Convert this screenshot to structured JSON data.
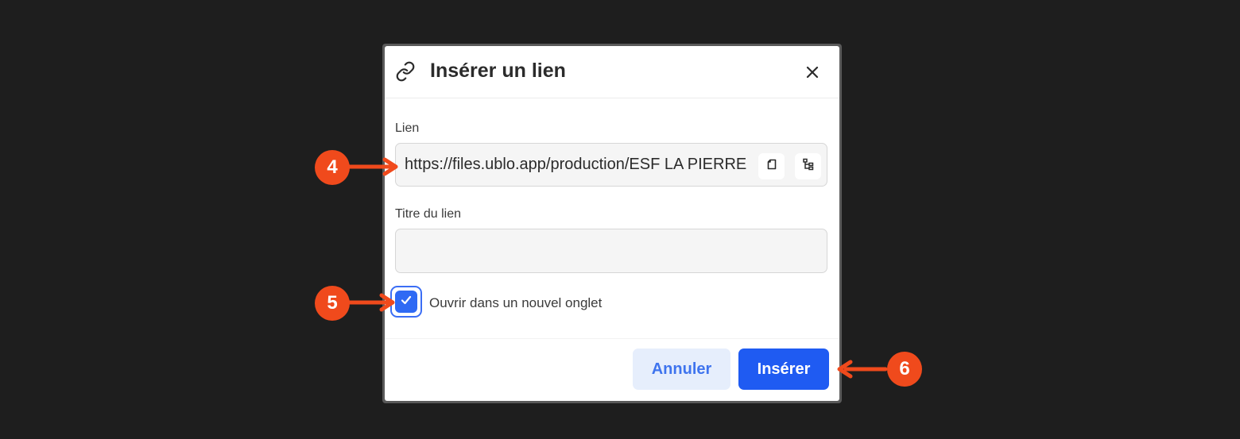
{
  "dialog": {
    "icon": "link-icon",
    "title": "Insérer un lien",
    "close_icon": "close-icon"
  },
  "link_field": {
    "label": "Lien",
    "value": "https://files.ublo.app/production/ESF LA PIERRE",
    "copy_icon": "copy-icon",
    "tree_icon": "tree-icon"
  },
  "title_field": {
    "label": "Titre du lien",
    "value": ""
  },
  "new_tab_option": {
    "label": "Ouvrir dans un nouvel onglet",
    "checked": true
  },
  "buttons": {
    "cancel_label": "Annuler",
    "insert_label": "Insérer"
  },
  "annotations": {
    "marker_4": "4",
    "marker_5": "5",
    "marker_6": "6",
    "color": "#f04a1c"
  },
  "colors": {
    "primary": "#1f5bf2",
    "secondary_bg": "#e6eefc",
    "background": "#1e1e1e"
  }
}
